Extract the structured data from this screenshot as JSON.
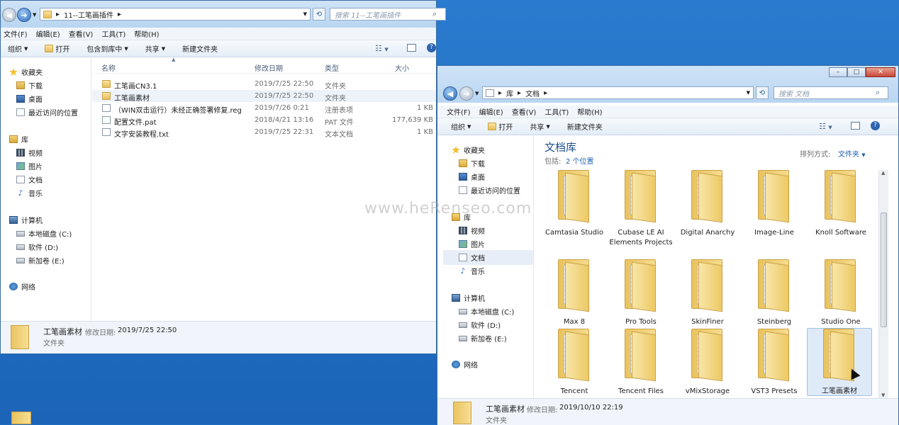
{
  "watermark": "www.heRenseo.com",
  "left_window": {
    "breadcrumb": [
      "11--工笔画插件"
    ],
    "search_placeholder": "搜索 11--工笔画插件",
    "menu": [
      "文件(F)",
      "编辑(E)",
      "查看(V)",
      "工具(T)",
      "帮助(H)"
    ],
    "toolbar": {
      "organize": "组织",
      "open": "打开",
      "include": "包含到库中",
      "share": "共享",
      "new_folder": "新建文件夹"
    },
    "nav": {
      "favorites": "收藏夹",
      "downloads": "下载",
      "desktop": "桌面",
      "recent": "最近访问的位置",
      "libraries": "库",
      "videos": "视频",
      "pictures": "图片",
      "documents": "文档",
      "music": "音乐",
      "computer": "计算机",
      "drive_c": "本地磁盘 (C:)",
      "drive_d": "软件 (D:)",
      "drive_e": "新加卷 (E:)",
      "network": "网络"
    },
    "columns": {
      "name": "名称",
      "date": "修改日期",
      "type": "类型",
      "size": "大小"
    },
    "files": [
      {
        "name": "工笔画CN3.1",
        "date": "2019/7/25 22:50",
        "type": "文件夹",
        "size": ""
      },
      {
        "name": "工笔画素材",
        "date": "2019/7/25 22:50",
        "type": "文件夹",
        "size": ""
      },
      {
        "name": "（WIN双击运行）未经正确签署修复.reg",
        "date": "2019/7/26 0:21",
        "type": "注册表项",
        "size": "1 KB"
      },
      {
        "name": "配置文件.pat",
        "date": "2018/4/21 13:16",
        "type": "PAT 文件",
        "size": "177,639 KB"
      },
      {
        "name": "文字安装教程.txt",
        "date": "2019/7/25 22:31",
        "type": "文本文档",
        "size": "1 KB"
      }
    ],
    "status": {
      "name": "工笔画素材",
      "date_label": "修改日期:",
      "date": "2019/7/25 22:50",
      "type": "文件夹"
    }
  },
  "right_window": {
    "breadcrumb": [
      "库",
      "文档"
    ],
    "search_placeholder": "搜索 文档",
    "menu": [
      "文件(F)",
      "编辑(E)",
      "查看(V)",
      "工具(T)",
      "帮助(H)"
    ],
    "toolbar": {
      "organize": "组织",
      "open": "打开",
      "share": "共享",
      "new_folder": "新建文件夹"
    },
    "nav": {
      "favorites": "收藏夹",
      "downloads": "下载",
      "desktop": "桌面",
      "recent": "最近访问的位置",
      "libraries": "库",
      "videos": "视频",
      "pictures": "图片",
      "documents": "文档",
      "music": "音乐",
      "computer": "计算机",
      "drive_c": "本地磁盘 (C:)",
      "drive_d": "软件 (D:)",
      "drive_e": "新加卷 (E:)",
      "network": "网络"
    },
    "library_title": "文档库",
    "includes_label": "包括:",
    "includes_value": "2 个位置",
    "arrange_label": "排列方式:",
    "arrange_value": "文件夹",
    "folders": [
      "Camtasia Studio",
      "Cubase LE AI Elements Projects",
      "Digital Anarchy",
      "Image-Line",
      "Knoll Software",
      "Max 8",
      "Pro Tools",
      "SkinFiner",
      "Steinberg",
      "Studio One",
      "Tencent",
      "Tencent Files",
      "vMixStorage",
      "VST3 Presets",
      "工笔画素材"
    ],
    "status": {
      "name": "工笔画素材",
      "date_label": "修改日期:",
      "date": "2019/10/10 22:19",
      "type": "文件夹"
    }
  }
}
